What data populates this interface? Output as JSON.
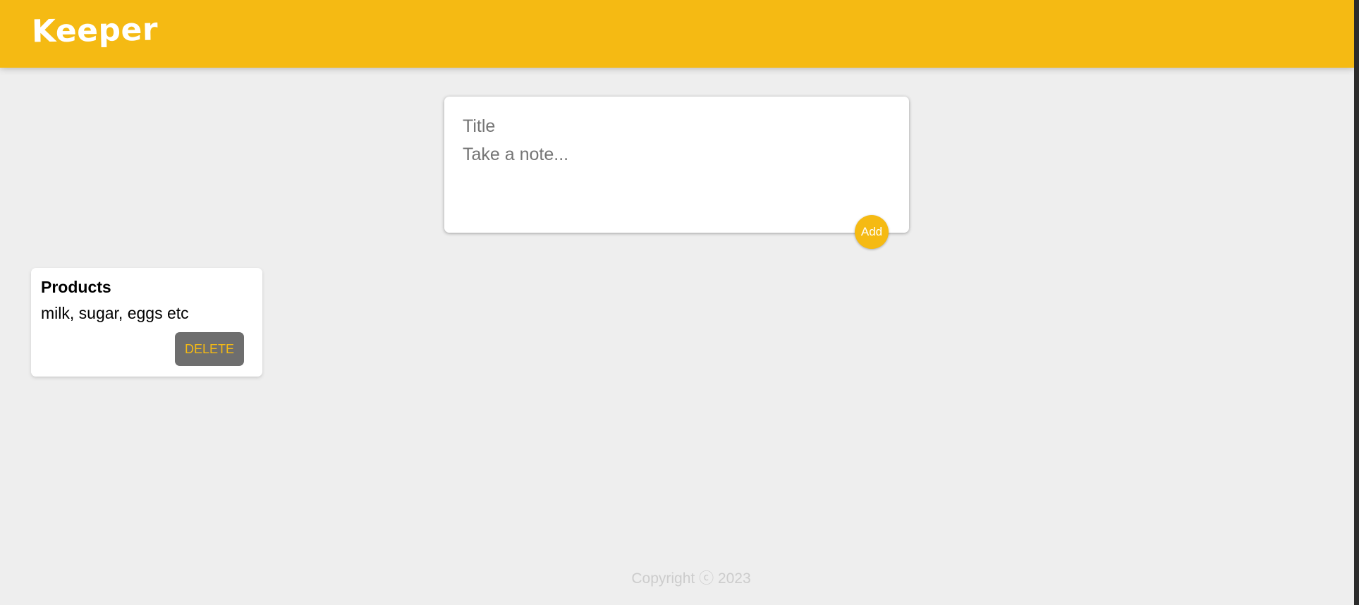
{
  "header": {
    "title": "Keeper"
  },
  "create_area": {
    "title_placeholder": "Title",
    "content_placeholder": "Take a note...",
    "add_label": "Add"
  },
  "notes": [
    {
      "title": "Products",
      "content": "milk, sugar, eggs etc",
      "delete_label": "DELETE"
    }
  ],
  "footer": {
    "copyright": "Copyright ⓒ 2023"
  },
  "colors": {
    "accent": "#f5ba13",
    "background": "#eeeeee",
    "delete_button": "#6e6e6e"
  }
}
